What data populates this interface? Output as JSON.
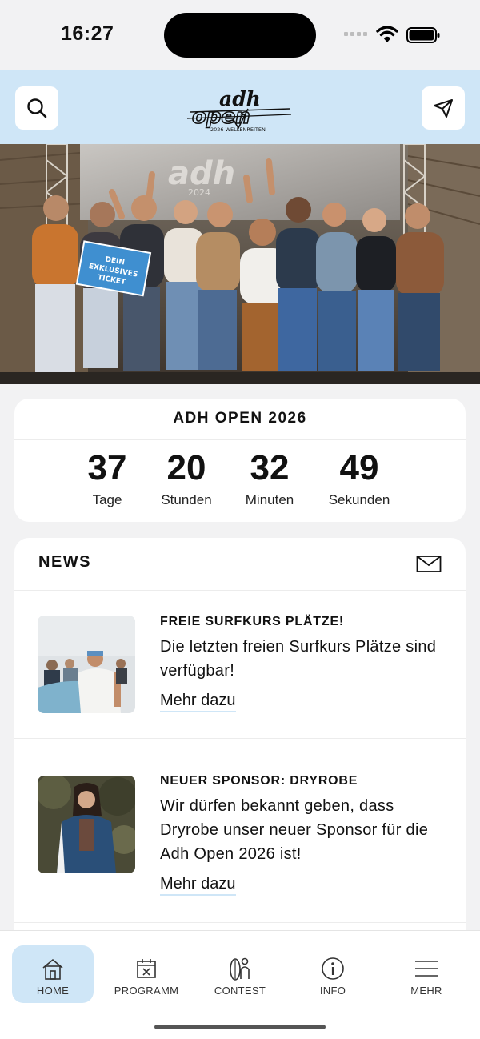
{
  "status": {
    "time": "16:27"
  },
  "header": {
    "logo_text": "adh open",
    "logo_sub": "2026 WELLENREITEN"
  },
  "countdown": {
    "title": "ADH OPEN 2026",
    "units": [
      {
        "value": "37",
        "label": "Tage"
      },
      {
        "value": "20",
        "label": "Stunden"
      },
      {
        "value": "32",
        "label": "Minuten"
      },
      {
        "value": "49",
        "label": "Sekunden"
      }
    ]
  },
  "news": {
    "title": "NEWS",
    "items": [
      {
        "headline": "FREIE SURFKURS PLÄTZE!",
        "text": "Die letzten freien Surfkurs Plätze sind verfügbar!",
        "link": "Mehr dazu"
      },
      {
        "headline": "NEUER SPONSOR: DRYROBE",
        "text": "Wir dürfen bekannt geben, dass Dryrobe unser neuer Sponsor für die Adh Open 2026 ist!",
        "link": "Mehr dazu"
      }
    ]
  },
  "tabs": [
    {
      "label": "HOME",
      "icon": "home-icon",
      "active": true
    },
    {
      "label": "PROGRAMM",
      "icon": "calendar-icon",
      "active": false
    },
    {
      "label": "CONTEST",
      "icon": "surfboard-person-icon",
      "active": false
    },
    {
      "label": "INFO",
      "icon": "info-icon",
      "active": false
    },
    {
      "label": "MEHR",
      "icon": "menu-icon",
      "active": false
    }
  ],
  "colors": {
    "accent": "#cfe6f7",
    "background": "#f2f2f3"
  }
}
